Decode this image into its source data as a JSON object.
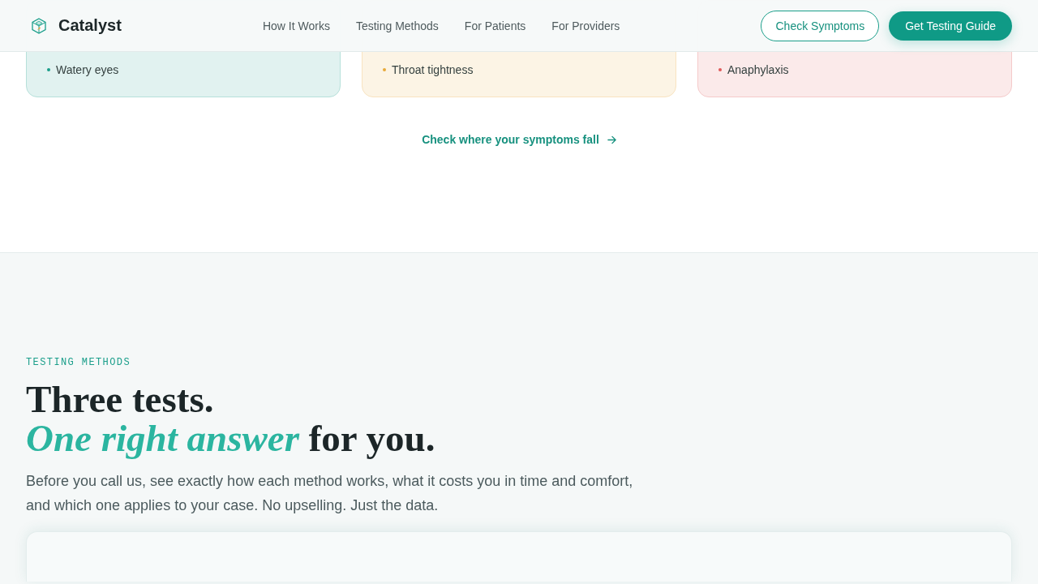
{
  "header": {
    "brand": "Catalyst",
    "nav": [
      {
        "label": "How It Works"
      },
      {
        "label": "Testing Methods"
      },
      {
        "label": "For Patients"
      },
      {
        "label": "For Providers"
      }
    ],
    "buttons": [
      {
        "label": "Check Symptoms",
        "kind": "outline"
      },
      {
        "label": "Get Testing Guide",
        "kind": "filled"
      }
    ]
  },
  "symptom_cards": [
    {
      "color": "#1a9e8a",
      "items": [
        "Watery eyes"
      ]
    },
    {
      "color": "#e8a93a",
      "items": [
        "Throat tightness"
      ]
    },
    {
      "color": "#e05a5a",
      "items": [
        "Anaphylaxis"
      ]
    }
  ],
  "symptom_link": {
    "label": "Check where your symptoms fall"
  },
  "testing_methods": {
    "eyebrow": "TESTING METHODS",
    "heading": [
      "Three tests.",
      "*One right answer* for you."
    ],
    "intro": "Before you call us, see exactly how each method works, what it costs you in time and comfort, and which one applies to your case. No upselling. Just the data."
  }
}
